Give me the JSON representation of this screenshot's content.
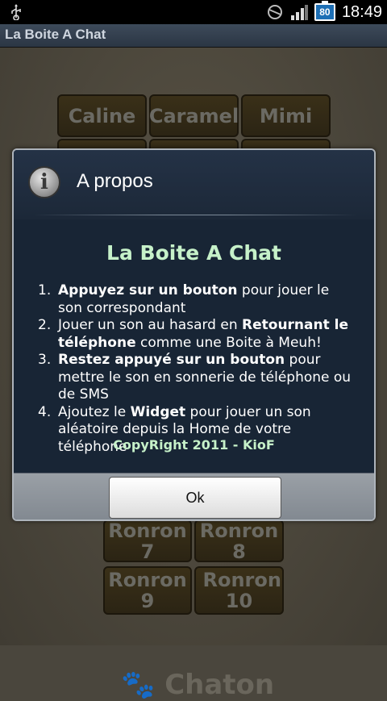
{
  "status_bar": {
    "time": "18:49",
    "battery_level": "80",
    "icons": [
      "usb-icon",
      "sync-icon",
      "signal-icon",
      "battery-icon"
    ]
  },
  "app": {
    "title": "La Boite A Chat"
  },
  "background": {
    "buttons": [
      "Caline",
      "Caramel",
      "Mimi",
      "Ronron 7",
      "Ronron 8",
      "Ronron 9",
      "Ronron 10"
    ],
    "section_title": "Chaton"
  },
  "dialog": {
    "title": "A propos",
    "icon": "info-icon",
    "body_title": "La Boite A Chat",
    "steps": [
      {
        "num": "1.",
        "bold": "Appuyez sur un bouton",
        "rest": " pour jouer le son correspondant"
      },
      {
        "num": "2.",
        "pre": "Jouer un son au hasard en ",
        "bold": "Retournant le téléphone",
        "rest": " comme une Boite à Meuh!"
      },
      {
        "num": "3.",
        "bold": "Restez appuyé sur un bouton",
        "rest": " pour mettre le son en sonnerie de téléphone ou de SMS"
      },
      {
        "num": "4.",
        "pre": "Ajoutez le ",
        "bold": "Widget",
        "rest": " pour jouer un son aléatoire depuis la Home de votre téléphone"
      }
    ],
    "copyright": "CopyRight 2011 - KioF",
    "ok_label": "Ok"
  }
}
